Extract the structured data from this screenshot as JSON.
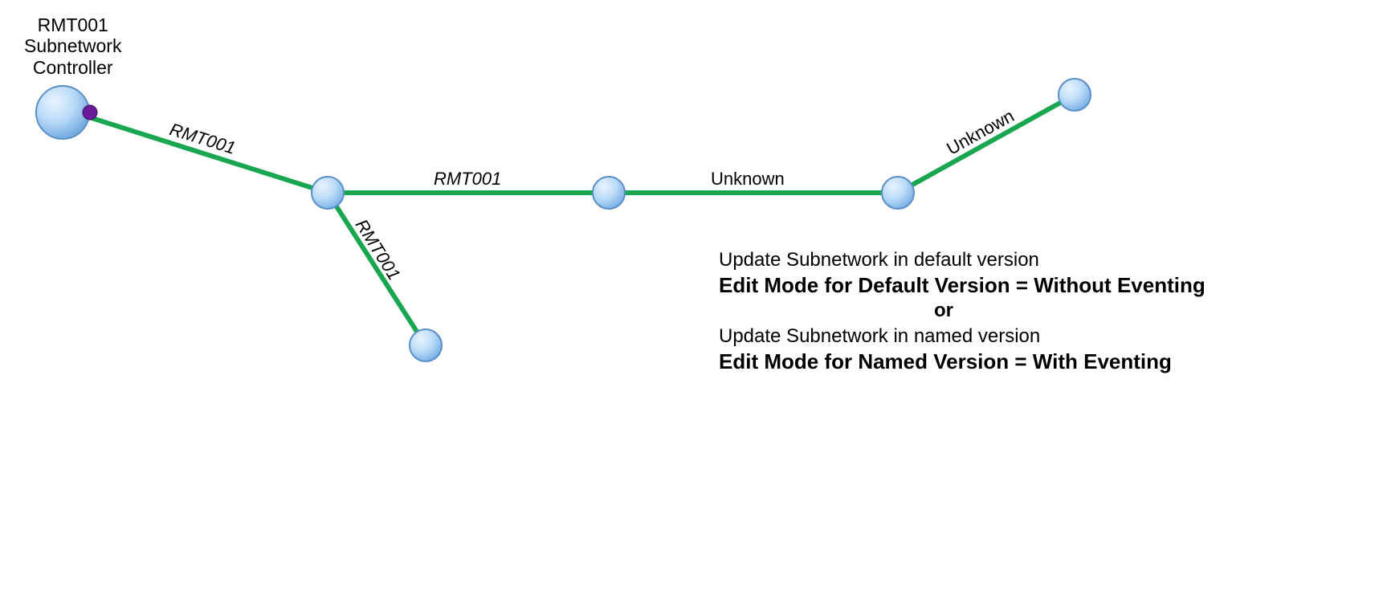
{
  "controller": {
    "label_line1": "RMT001",
    "label_line2": "Subnetwork",
    "label_line3": "Controller"
  },
  "edges": {
    "e1": "RMT001",
    "e2": "RMT001",
    "e3": "RMT001",
    "e4": "Unknown",
    "e5": "Unknown"
  },
  "info": {
    "line1": "Update Subnetwork in default version",
    "line2": "Edit Mode for Default Version = Without Eventing",
    "or": "or",
    "line3": "Update Subnetwork in named version",
    "line4": "Edit Mode for Named Version = With Eventing"
  },
  "colors": {
    "edge": "#18a651",
    "node_fill_light": "#d4e8fb",
    "node_fill_dark": "#8fc0ed",
    "node_stroke": "#5a8fc7",
    "controller_dot": "#6a1b9a"
  }
}
